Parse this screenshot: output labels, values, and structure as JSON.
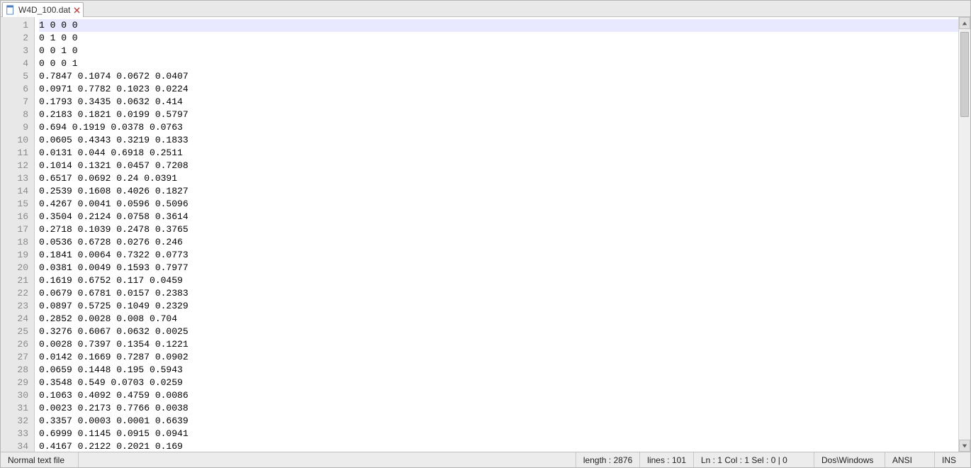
{
  "tab": {
    "filename": "W4D_100.dat"
  },
  "editor": {
    "active_line": 1,
    "lines": [
      "1 0 0 0",
      "0 1 0 0",
      "0 0 1 0",
      "0 0 0 1",
      "0.7847 0.1074 0.0672 0.0407",
      "0.0971 0.7782 0.1023 0.0224",
      "0.1793 0.3435 0.0632 0.414",
      "0.2183 0.1821 0.0199 0.5797",
      "0.694 0.1919 0.0378 0.0763",
      "0.0605 0.4343 0.3219 0.1833",
      "0.0131 0.044 0.6918 0.2511",
      "0.1014 0.1321 0.0457 0.7208",
      "0.6517 0.0692 0.24 0.0391",
      "0.2539 0.1608 0.4026 0.1827",
      "0.4267 0.0041 0.0596 0.5096",
      "0.3504 0.2124 0.0758 0.3614",
      "0.2718 0.1039 0.2478 0.3765",
      "0.0536 0.6728 0.0276 0.246",
      "0.1841 0.0064 0.7322 0.0773",
      "0.0381 0.0049 0.1593 0.7977",
      "0.1619 0.6752 0.117 0.0459",
      "0.0679 0.6781 0.0157 0.2383",
      "0.0897 0.5725 0.1049 0.2329",
      "0.2852 0.0028 0.008 0.704",
      "0.3276 0.6067 0.0632 0.0025",
      "0.0028 0.7397 0.1354 0.1221",
      "0.0142 0.1669 0.7287 0.0902",
      "0.0659 0.1448 0.195 0.5943",
      "0.3548 0.549 0.0703 0.0259",
      "0.1063 0.4092 0.4759 0.0086",
      "0.0023 0.2173 0.7766 0.0038",
      "0.3357 0.0003 0.0001 0.6639",
      "0.6999 0.1145 0.0915 0.0941",
      "0.4167 0.2122 0.2021 0.169"
    ]
  },
  "status": {
    "filetype": "Normal text file",
    "length_label": "length : 2876",
    "lines_label": "lines : 101",
    "pos_label": "Ln : 1   Col : 1   Sel : 0 | 0",
    "eol": "Dos\\Windows",
    "encoding": "ANSI",
    "ins": "INS"
  }
}
